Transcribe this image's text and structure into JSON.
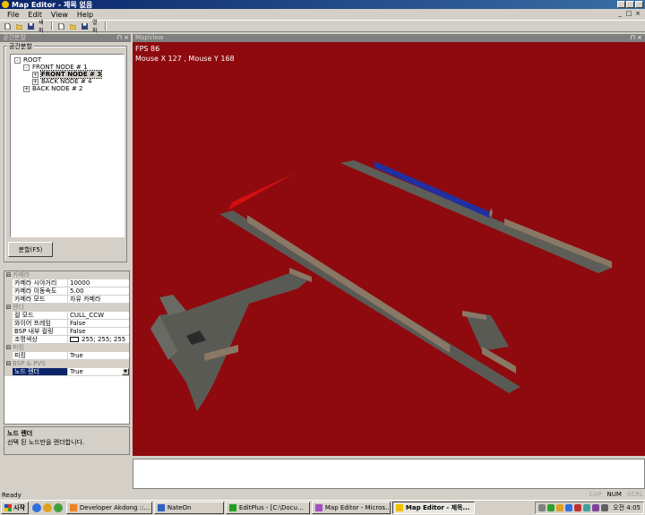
{
  "window": {
    "title": "Map Editor - 제목 없음"
  },
  "menu": {
    "items": [
      "File",
      "Edit",
      "View",
      "Help"
    ]
  },
  "toolbar": {
    "new_label": "새파",
    "open_label": "열파"
  },
  "left_panel": {
    "header": "공간분할",
    "group_title": "공간분할",
    "tree": [
      {
        "label": "ROOT",
        "indent": 0,
        "expander": "-"
      },
      {
        "label": "FRONT NODE # 1",
        "indent": 1,
        "expander": "-"
      },
      {
        "label": "FRONT NODE # 3",
        "indent": 2,
        "expander": "+",
        "selected": true
      },
      {
        "label": "BACK NODE # 4",
        "indent": 2,
        "expander": "+"
      },
      {
        "label": "BACK NODE # 2",
        "indent": 1,
        "expander": "+"
      }
    ],
    "split_button": "분할(F5)"
  },
  "properties": {
    "categories": [
      {
        "name": "카메라",
        "rows": [
          {
            "name": "카메라 시야거리",
            "value": "10000"
          },
          {
            "name": "카메라 이동속도",
            "value": "5.00"
          },
          {
            "name": "카메라 모드",
            "value": "자유 카메라"
          }
        ]
      },
      {
        "name": "렌더",
        "rows": [
          {
            "name": "컬 모드",
            "value": "CULL_CCW"
          },
          {
            "name": "와이어 프레임",
            "value": "False"
          },
          {
            "name": "BSP 내부 컬링",
            "value": "False"
          },
          {
            "name": "조명색상",
            "value": "255; 255; 255",
            "swatch": true
          }
        ]
      },
      {
        "name": "피킹",
        "rows": [
          {
            "name": "피킹",
            "value": "True"
          }
        ]
      },
      {
        "name": "BSP & PVS",
        "rows": [
          {
            "name": "노드 렌더",
            "value": "True",
            "selected": true,
            "dropdown": true
          }
        ]
      }
    ],
    "description_title": "노드 렌더",
    "description_text": "선택 된 노드만을 렌더합니다."
  },
  "map_view": {
    "header": "MapView",
    "fps": "FPS 86",
    "mouse": "Mouse X 127 , Mouse Y  168",
    "background_color": "#8e0a0e"
  },
  "status": {
    "text": "Ready",
    "indicators": [
      {
        "label": "CAP",
        "on": false
      },
      {
        "label": "NUM",
        "on": true
      },
      {
        "label": "SCRL",
        "on": false
      }
    ]
  },
  "taskbar": {
    "start": "시작",
    "tasks": [
      {
        "label": "Developer Akdong ::...",
        "color": "#f08020"
      },
      {
        "label": "NateOn",
        "color": "#3060c0"
      },
      {
        "label": "EditPlus - [C:\\Docu...",
        "color": "#20a020"
      },
      {
        "label": "Map Editor - Micros...",
        "color": "#a050c0"
      },
      {
        "label": "Map Editor - 제목...",
        "color": "#f0c000",
        "active": true
      }
    ],
    "clock": "오전 4:05"
  }
}
